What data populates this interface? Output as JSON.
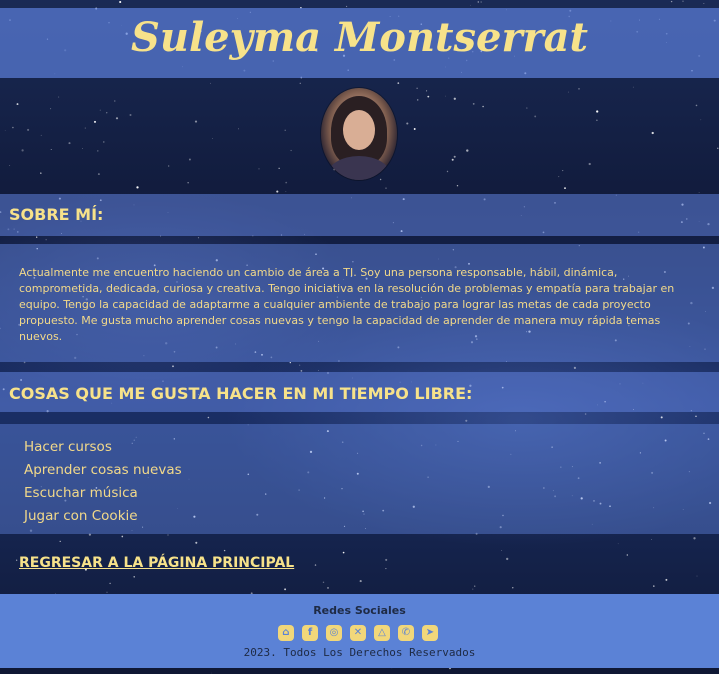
{
  "header": {
    "title": "Suleyma Montserrat"
  },
  "about": {
    "heading": "SOBRE MÍ:",
    "text": "Actualmente me encuentro haciendo un cambio de área a TI. Soy una persona responsable, hábil, dinámica, comprometida, dedicada, curiosa y creativa. Tengo iniciativa en la resolución de problemas y empatía para trabajar en equipo. Tengo la capacidad de adaptarme a cualquier ambiente de trabajo para lograr las metas de cada proyecto propuesto. Me gusta mucho aprender cosas nuevas y tengo la capacidad de aprender de manera muy rápida temas nuevos."
  },
  "hobbies": {
    "heading": "COSAS QUE ME GUSTA HACER EN MI TIEMPO LIBRE:",
    "items": [
      "Hacer cursos",
      "Aprender cosas nuevas",
      "Escuchar música",
      "Jugar con Cookie"
    ]
  },
  "back_link": "REGRESAR A LA PÁGINA PRINCIPAL",
  "footer": {
    "title": "Redes Sociales",
    "icons": [
      {
        "name": "github-icon",
        "glyph": "⌂"
      },
      {
        "name": "facebook-icon",
        "glyph": "f"
      },
      {
        "name": "instagram-icon",
        "glyph": "◎"
      },
      {
        "name": "x-twitter-icon",
        "glyph": "✕"
      },
      {
        "name": "snapchat-icon",
        "glyph": "△"
      },
      {
        "name": "whatsapp-icon",
        "glyph": "✆"
      },
      {
        "name": "telegram-icon",
        "glyph": "➤"
      }
    ],
    "copyright": "2023. Todos Los Derechos Reservados"
  },
  "colors": {
    "accent": "#f7e28a",
    "band": "#6082dc",
    "footer": "#5b82d6"
  }
}
